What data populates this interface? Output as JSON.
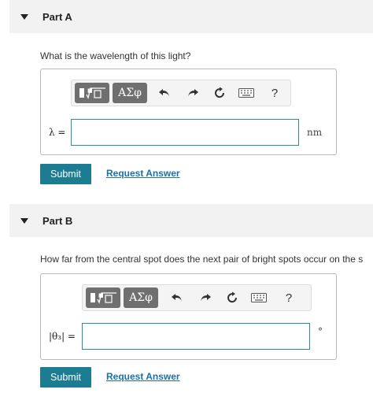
{
  "part_a": {
    "title": "Part A",
    "question": "What is the wavelength of this light?",
    "toolbar": {
      "templates_icon": "fraction-sqrt-icon",
      "symbols_label": "ΑΣφ",
      "help_label": "?"
    },
    "input_label": "λ =",
    "input_value": "",
    "unit": "nm",
    "submit_label": "Submit",
    "request_label": "Request Answer"
  },
  "part_b": {
    "title": "Part B",
    "question": "How far from the central spot does the next pair of bright spots occur on the s",
    "toolbar": {
      "templates_icon": "fraction-sqrt-icon",
      "symbols_label": "ΑΣφ",
      "help_label": "?"
    },
    "input_label": "|θ₃| =",
    "input_value": "",
    "unit": "°",
    "submit_label": "Submit",
    "request_label": "Request Answer"
  }
}
